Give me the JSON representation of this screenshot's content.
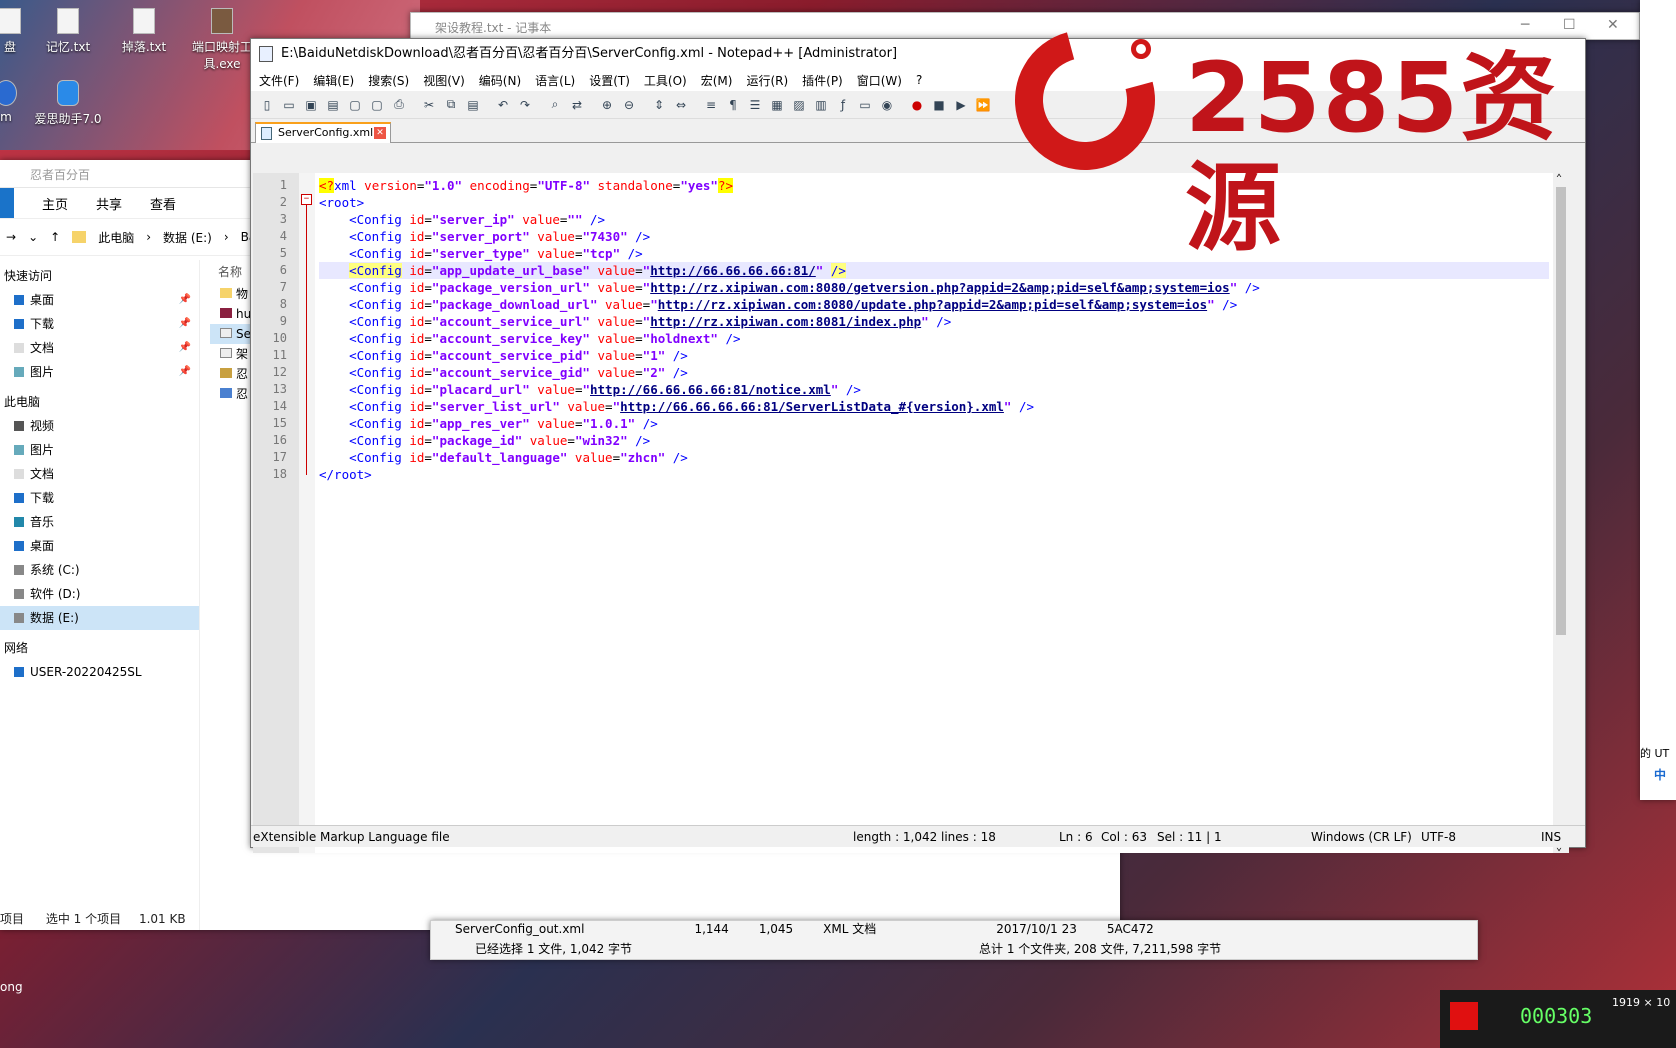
{
  "desktop": {
    "icons": [
      {
        "label": "盘"
      },
      {
        "label": "记忆.txt"
      },
      {
        "label": "掉落.txt"
      },
      {
        "label": "端口映射工具.exe"
      },
      {
        "label": "m"
      },
      {
        "label": "爱思助手7.0"
      }
    ],
    "side_text": "ong"
  },
  "explorer": {
    "quick_bar_path": "忍者百分百",
    "ribbon": [
      "主页",
      "共享",
      "查看"
    ],
    "breadcrumb": [
      "此电脑",
      "数据 (E:)",
      "Ba"
    ],
    "column_name": "名称",
    "nav": {
      "quick_access": "快速访问",
      "quick": [
        "桌面",
        "下载",
        "文档",
        "图片"
      ],
      "this_pc": "此电脑",
      "pc": [
        "视频",
        "图片",
        "文档",
        "下载",
        "音乐",
        "桌面",
        "系统 (C:)",
        "软件 (D:)",
        "数据 (E:)"
      ],
      "network": "网络",
      "computer": "USER-20220425SL"
    },
    "files": [
      "物",
      "hu",
      "Se",
      "架",
      "忍",
      "忍"
    ],
    "status": {
      "items": "项目",
      "selected": "选中 1 个项目",
      "size": "1.01 KB"
    }
  },
  "explorer2": {
    "row": [
      "ServerConfig_out.xml",
      "1,144",
      "1,045",
      "XML 文档",
      "2017/10/1 23",
      "5AC472"
    ],
    "status_left": "已经选择 1 文件, 1,042 字节",
    "status_right": "总计 1 个文件夹, 208 文件, 7,211,598 字节"
  },
  "notepad_bg": {
    "title": "架设教程.txt - 记事本"
  },
  "npp": {
    "title": "E:\\BaiduNetdiskDownload\\忍者百分百\\忍者百分百\\ServerConfig.xml - Notepad++ [Administrator]",
    "menu": [
      "文件(F)",
      "编辑(E)",
      "搜索(S)",
      "视图(V)",
      "编码(N)",
      "语言(L)",
      "设置(T)",
      "工具(O)",
      "宏(M)",
      "运行(R)",
      "插件(P)",
      "窗口(W)",
      "?"
    ],
    "tab": "ServerConfig.xml",
    "configs": [
      {
        "id": "server_ip",
        "value": ""
      },
      {
        "id": "server_port",
        "value": "7430"
      },
      {
        "id": "server_type",
        "value": "tcp"
      },
      {
        "id": "app_update_url_base",
        "value": "http://66.66.66.66:81/"
      },
      {
        "id": "package_version_url",
        "value": "http://rz.xipiwan.com:8080/getversion.php?appid=2&amp;pid=self&amp;system=ios"
      },
      {
        "id": "package_download_url",
        "value": "http://rz.xipiwan.com:8080/update.php?appid=2&amp;pid=self&amp;system=ios"
      },
      {
        "id": "account_service_url",
        "value": "http://rz.xipiwan.com:8081/index.php"
      },
      {
        "id": "account_service_key",
        "value": "holdnext"
      },
      {
        "id": "account_service_pid",
        "value": "1"
      },
      {
        "id": "account_service_gid",
        "value": "2"
      },
      {
        "id": "placard_url",
        "value": "http://66.66.66.66:81/notice.xml"
      },
      {
        "id": "server_list_url",
        "value": "http://66.66.66.66:81/ServerListData_#{version}.xml"
      },
      {
        "id": "app_res_ver",
        "value": "1.0.1"
      },
      {
        "id": "package_id",
        "value": "win32"
      },
      {
        "id": "default_language",
        "value": "zhcn"
      }
    ],
    "xml_decl": {
      "version": "1.0",
      "encoding": "UTF-8",
      "standalone": "yes"
    },
    "status": {
      "type": "eXtensible Markup Language file",
      "length": "length : 1,042",
      "lines": "lines : 18",
      "ln": "Ln : 6",
      "col": "Col : 63",
      "sel": "Sel : 11 | 1",
      "eol": "Windows (CR LF)",
      "enc": "UTF-8",
      "ins": "INS"
    }
  },
  "watermark": {
    "text": "2585资源"
  },
  "recorder": {
    "counter": "000303",
    "resolution": "1919 × 10"
  },
  "right_panel": {
    "text": "的 UT",
    "ime": "中"
  },
  "colors": {
    "xml_tag": "#0000ff",
    "xml_attr": "#ff0000",
    "xml_value": "#8000ff",
    "logo": "#c0141a"
  }
}
